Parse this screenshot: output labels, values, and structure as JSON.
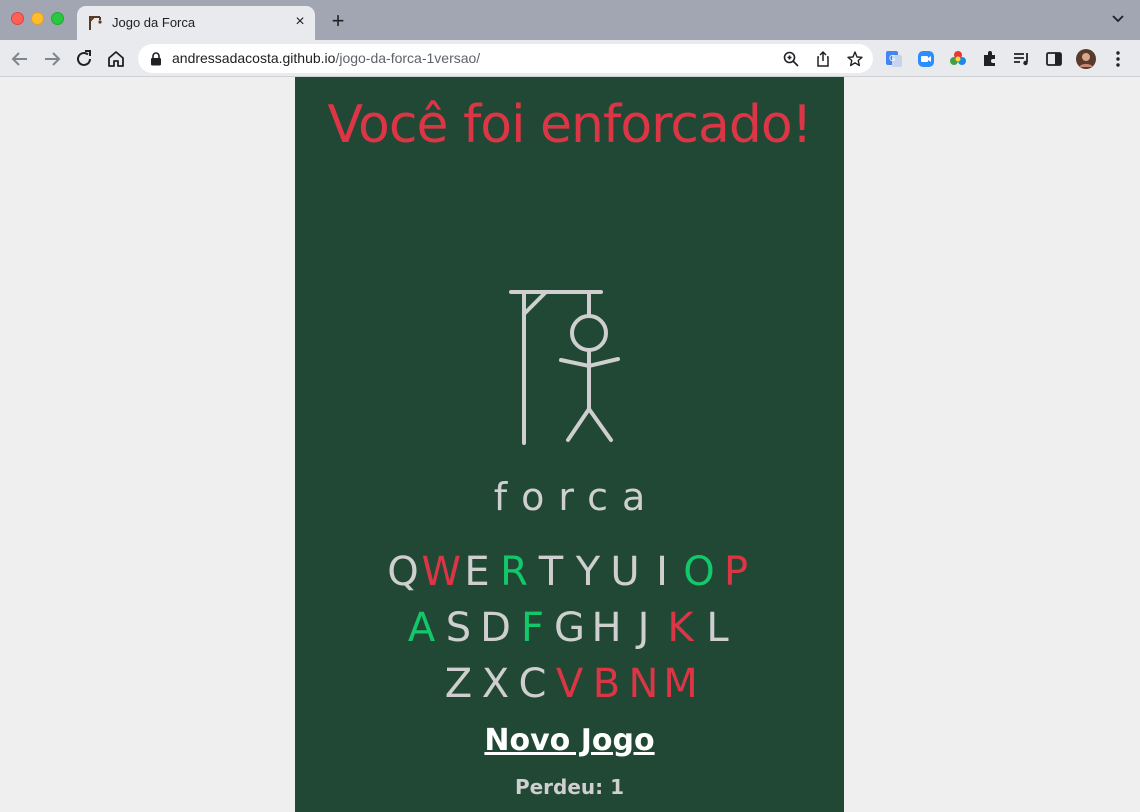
{
  "browser": {
    "tab_title": "Jogo da Forca",
    "tab_close": "×",
    "new_tab": "+",
    "url_host": "andressadacosta.github.io",
    "url_path": "/jogo-da-forca-1versao/"
  },
  "game": {
    "headline": "Você foi enforcado!",
    "word": "forca",
    "new_game_label": "Novo Jogo",
    "score": "Perdeu: 1",
    "colors": {
      "board": "#214835",
      "correct": "#12c86a",
      "wrong": "#dc3545",
      "unused": "#cfcfcf"
    },
    "keyboard": [
      [
        {
          "letter": "Q",
          "state": "unused"
        },
        {
          "letter": "W",
          "state": "wrong"
        },
        {
          "letter": "E",
          "state": "unused"
        },
        {
          "letter": "R",
          "state": "correct"
        },
        {
          "letter": "T",
          "state": "unused"
        },
        {
          "letter": "Y",
          "state": "unused"
        },
        {
          "letter": "U",
          "state": "unused"
        },
        {
          "letter": "I",
          "state": "unused"
        },
        {
          "letter": "O",
          "state": "correct"
        },
        {
          "letter": "P",
          "state": "wrong"
        }
      ],
      [
        {
          "letter": "A",
          "state": "correct"
        },
        {
          "letter": "S",
          "state": "unused"
        },
        {
          "letter": "D",
          "state": "unused"
        },
        {
          "letter": "F",
          "state": "correct"
        },
        {
          "letter": "G",
          "state": "unused"
        },
        {
          "letter": "H",
          "state": "unused"
        },
        {
          "letter": "J",
          "state": "unused"
        },
        {
          "letter": "K",
          "state": "wrong"
        },
        {
          "letter": "L",
          "state": "unused"
        }
      ],
      [
        {
          "letter": "Z",
          "state": "unused"
        },
        {
          "letter": "X",
          "state": "unused"
        },
        {
          "letter": "C",
          "state": "unused"
        },
        {
          "letter": "V",
          "state": "wrong"
        },
        {
          "letter": "B",
          "state": "wrong"
        },
        {
          "letter": "N",
          "state": "wrong"
        },
        {
          "letter": "M",
          "state": "wrong"
        }
      ]
    ]
  }
}
